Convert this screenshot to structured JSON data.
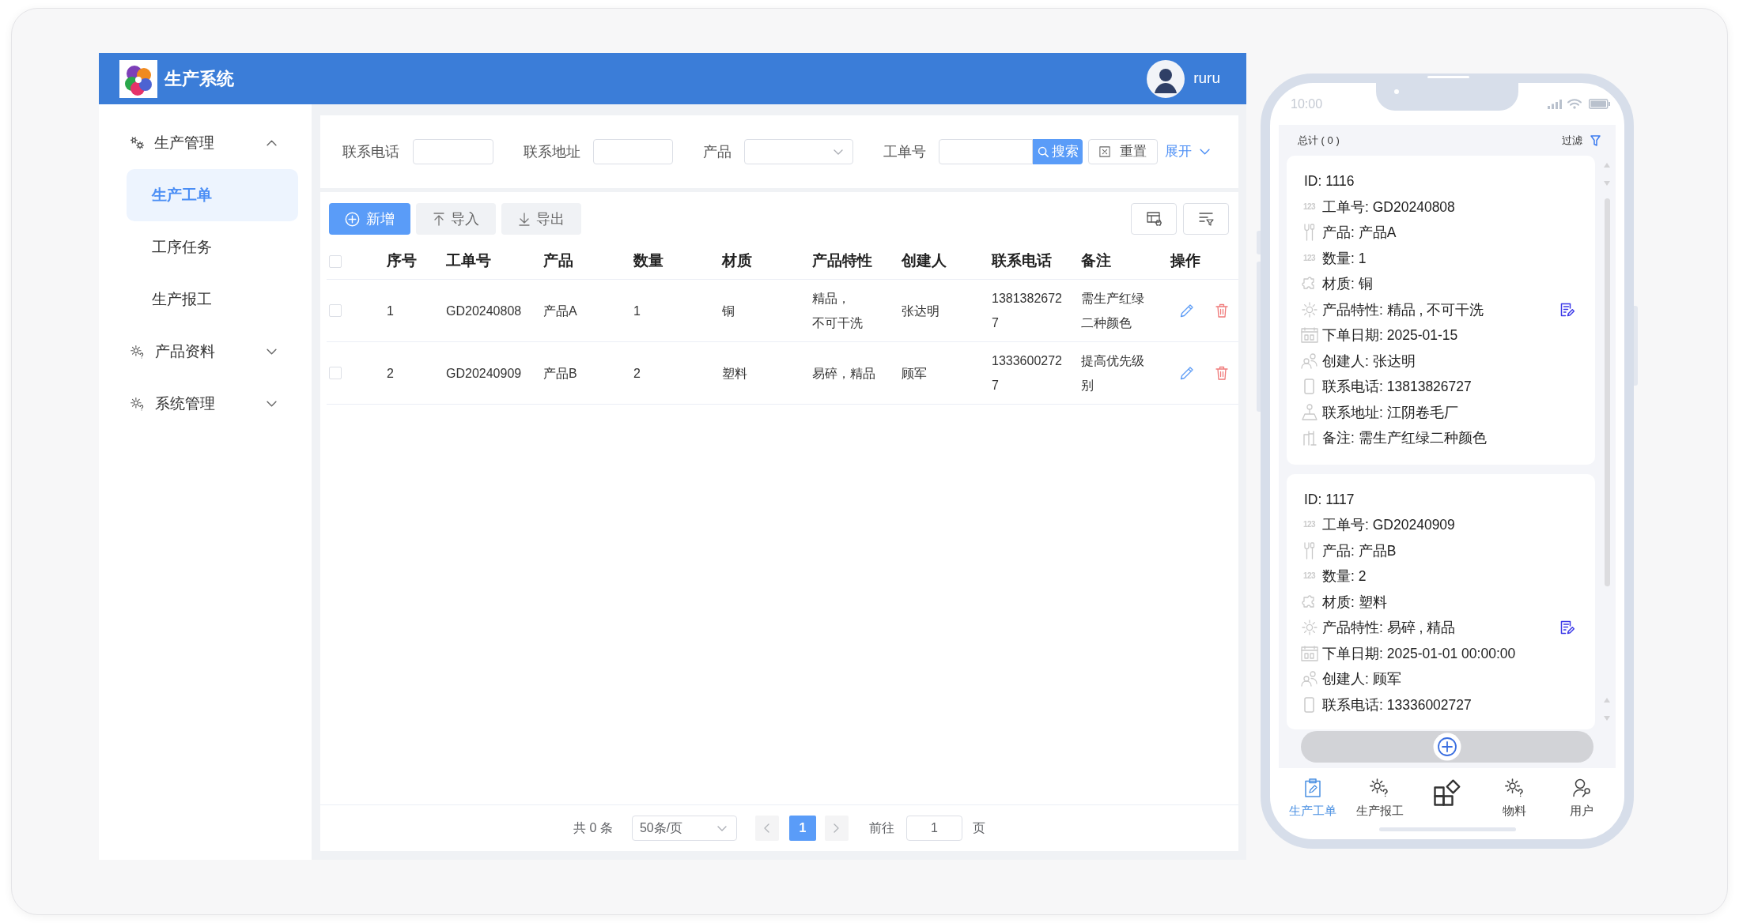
{
  "header": {
    "title": "生产系统",
    "user": "ruru"
  },
  "sidebar": {
    "items": [
      {
        "label": "生产管理",
        "expanded": true,
        "children": [
          {
            "label": "生产工单",
            "selected": true
          },
          {
            "label": "工序任务",
            "selected": false
          },
          {
            "label": "生产报工",
            "selected": false
          }
        ]
      },
      {
        "label": "产品资料",
        "expanded": false
      },
      {
        "label": "系统管理",
        "expanded": false
      }
    ]
  },
  "filters": {
    "fields": [
      {
        "label": "联系电话",
        "kind": "input"
      },
      {
        "label": "联系地址",
        "kind": "input"
      },
      {
        "label": "产品",
        "kind": "select"
      },
      {
        "label": "工单号",
        "kind": "input"
      }
    ],
    "search_button": "搜索",
    "reset_button": "重置",
    "expand_link": "展开"
  },
  "toolbar": {
    "buttons": [
      {
        "label": "新增",
        "kind": "primary"
      },
      {
        "label": "导入",
        "kind": "plain"
      },
      {
        "label": "导出",
        "kind": "plain"
      }
    ]
  },
  "table": {
    "select_all": {
      "checked": false
    },
    "columns": [
      "序号",
      "工单号",
      "产品",
      "数量",
      "材质",
      "产品特性",
      "创建人",
      "联系电话",
      "备注",
      "操作"
    ],
    "rows": [
      {
        "checked": false,
        "cells": [
          "1",
          "GD20240808",
          "产品A",
          "1",
          "铜",
          "精品，不可干洗",
          "张达明",
          "13813826727",
          "需生产红绿二种颜色"
        ],
        "actions": [
          {
            "kind": "edit"
          },
          {
            "kind": "delete"
          }
        ]
      },
      {
        "checked": false,
        "cells": [
          "2",
          "GD20240909",
          "产品B",
          "2",
          "塑料",
          "易碎，精品",
          "顾军",
          "13336002727",
          "提高优先级别"
        ],
        "actions": [
          {
            "kind": "edit"
          },
          {
            "kind": "delete"
          }
        ]
      }
    ]
  },
  "pagination": {
    "total": "共 0 条",
    "page_size": "50条/页",
    "pages": [
      {
        "label": "1",
        "selected": true
      }
    ],
    "goto_label": "前往",
    "goto_value": "1",
    "goto_suffix": "页"
  },
  "phone": {
    "status_time": "10:00",
    "list_total": "总计 ( 0 )",
    "filter_label": "过滤",
    "cards": [
      {
        "id": "ID: 1116",
        "fields": [
          {
            "kind": "number",
            "glyph": "123",
            "text": "工单号: GD20240808",
            "editable": false
          },
          {
            "kind": "tools",
            "text": "产品: 产品A",
            "editable": false
          },
          {
            "kind": "number",
            "glyph": "123",
            "text": "数量: 1",
            "editable": false
          },
          {
            "kind": "puzzle",
            "text": "材质: 铜",
            "editable": false
          },
          {
            "kind": "sun",
            "text": "产品特性: 精品 , 不可干洗",
            "editable": true
          },
          {
            "kind": "calendar",
            "text": "下单日期: 2025-01-15",
            "editable": false
          },
          {
            "kind": "users",
            "text": "创建人: 张达明",
            "editable": false
          },
          {
            "kind": "mobile",
            "text": "联系电话: 13813826727",
            "editable": false
          },
          {
            "kind": "location",
            "text": "联系地址: 江阴卷毛厂",
            "editable": false
          },
          {
            "kind": "ruler",
            "text": "备注: 需生产红绿二种颜色",
            "editable": false
          }
        ]
      },
      {
        "id": "ID: 1117",
        "fields": [
          {
            "kind": "number",
            "glyph": "123",
            "text": "工单号: GD20240909",
            "editable": false
          },
          {
            "kind": "tools",
            "text": "产品: 产品B",
            "editable": false
          },
          {
            "kind": "number",
            "glyph": "123",
            "text": "数量: 2",
            "editable": false
          },
          {
            "kind": "puzzle",
            "text": "材质: 塑料",
            "editable": false
          },
          {
            "kind": "sun",
            "text": "产品特性: 易碎 , 精品",
            "editable": true
          },
          {
            "kind": "calendar",
            "text": "下单日期: 2025-01-01 00:00:00",
            "editable": false
          },
          {
            "kind": "users",
            "text": "创建人: 顾军",
            "editable": false
          },
          {
            "kind": "mobile",
            "text": "联系电话: 13336002727",
            "editable": false
          }
        ]
      }
    ],
    "tabs": [
      {
        "kind": "tab",
        "label": "生产工单",
        "selected": true
      },
      {
        "kind": "tab",
        "label": "生产报工",
        "selected": false
      },
      {
        "kind": "center",
        "selected": false
      },
      {
        "kind": "tab",
        "label": "物料",
        "selected": false
      },
      {
        "kind": "tab",
        "label": "用户",
        "selected": false
      }
    ]
  }
}
